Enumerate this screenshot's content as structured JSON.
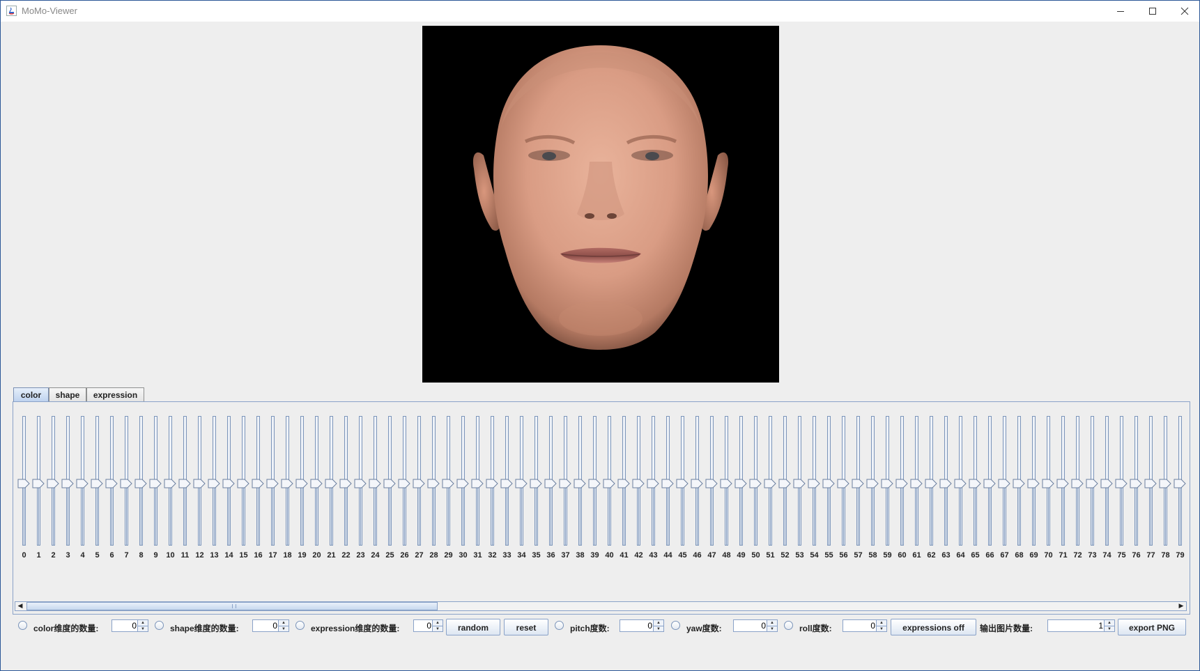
{
  "window": {
    "title": "MoMo-Viewer",
    "controls": [
      "minimize",
      "maximize",
      "close"
    ]
  },
  "viewport": {
    "content": "rendered-3d-face",
    "background": "#000000"
  },
  "tabs": [
    {
      "label": "color",
      "active": true
    },
    {
      "label": "shape",
      "active": false
    },
    {
      "label": "expression",
      "active": false
    }
  ],
  "sliders": {
    "labels": [
      "0",
      "1",
      "2",
      "3",
      "4",
      "5",
      "6",
      "7",
      "8",
      "9",
      "10",
      "11",
      "12",
      "13",
      "14",
      "15",
      "16",
      "17",
      "18",
      "19",
      "20",
      "21",
      "22",
      "23",
      "24",
      "25",
      "26",
      "27",
      "28",
      "29",
      "30",
      "31",
      "32",
      "33",
      "34",
      "35",
      "36",
      "37",
      "38",
      "39",
      "40",
      "41",
      "42",
      "43",
      "44",
      "45",
      "46",
      "47",
      "48",
      "49",
      "50",
      "51",
      "52",
      "53",
      "54",
      "55",
      "56",
      "57",
      "58",
      "59",
      "60",
      "61",
      "62",
      "63",
      "64",
      "65",
      "66",
      "67",
      "68",
      "69",
      "70",
      "71",
      "72",
      "73",
      "74",
      "75",
      "76",
      "77",
      "78",
      "79"
    ],
    "position": 0.5
  },
  "controls": {
    "color_dims_label": "color维度的数量:",
    "color_dims_value": "0",
    "shape_dims_label": "shape维度的数量:",
    "shape_dims_value": "0",
    "expression_dims_label": "expression维度的数量:",
    "expression_dims_value": "0",
    "random_button": "random",
    "reset_button": "reset",
    "pitch_label": "pitch度数:",
    "pitch_value": "0",
    "yaw_label": "yaw度数:",
    "yaw_value": "0",
    "roll_label": "roll度数:",
    "roll_value": "0",
    "expressions_button": "expressions off",
    "output_count_label": "输出图片数量:",
    "output_count_value": "1",
    "export_button": "export PNG"
  },
  "colors": {
    "accent": "#8aa2c8",
    "window_border": "#2b5797",
    "panel_bg": "#eeeeee"
  }
}
